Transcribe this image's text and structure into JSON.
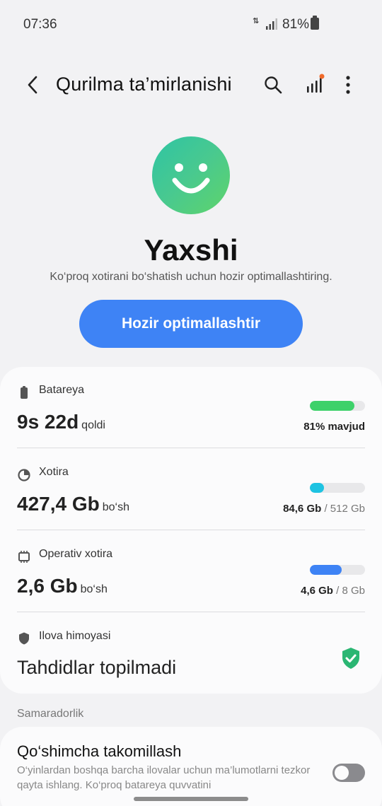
{
  "status_bar": {
    "time": "07:36",
    "battery": "81%",
    "icons": [
      "data-transfer-icon",
      "signal-icon",
      "battery-icon"
    ]
  },
  "app_bar": {
    "title": "Qurilma ta’mirlanishi",
    "icons": [
      "back-icon",
      "search-icon",
      "chart-icon",
      "more-icon"
    ]
  },
  "hero": {
    "status": "Yaxshi",
    "subtitle": "Ko‘proq xotirani bo‘shatish uchun hozir optimallashtiring.",
    "button": "Hozir optimallashtir"
  },
  "items": {
    "battery": {
      "label": "Batareya",
      "value": "9s 22d",
      "unit": "qoldi",
      "side_strong": "81% mavjud",
      "fill": 0.81,
      "color": "#3ed16a"
    },
    "storage": {
      "label": "Xotira",
      "value": "427,4 Gb",
      "unit": "bo‘sh",
      "side_strong": "84,6 Gb",
      "side_rest": " / 512 Gb",
      "fill": 0.165,
      "color": "#1ec3e2"
    },
    "ram": {
      "label": "Operativ xotira",
      "value": "2,6 Gb",
      "unit": "bo‘sh",
      "side_strong": "4,6 Gb",
      "side_rest": " / 8 Gb",
      "fill": 0.575,
      "color": "#3e83f5"
    },
    "protection": {
      "label": "Ilova himoyasi",
      "value": "Tahdidlar topilmadi"
    }
  },
  "section": {
    "header": "Samaradorlik"
  },
  "enhance": {
    "title": "Qo‘shimcha takomillash",
    "desc": "O‘yinlardan boshqa barcha ilovalar uchun ma’lumotlarni tezkor qayta ishlang. Ko‘proq batareya quvvatini",
    "toggle_on": false
  },
  "colors": {
    "accent": "#3e83f5",
    "good": "#3ed16a",
    "shield": "#2bb673"
  }
}
